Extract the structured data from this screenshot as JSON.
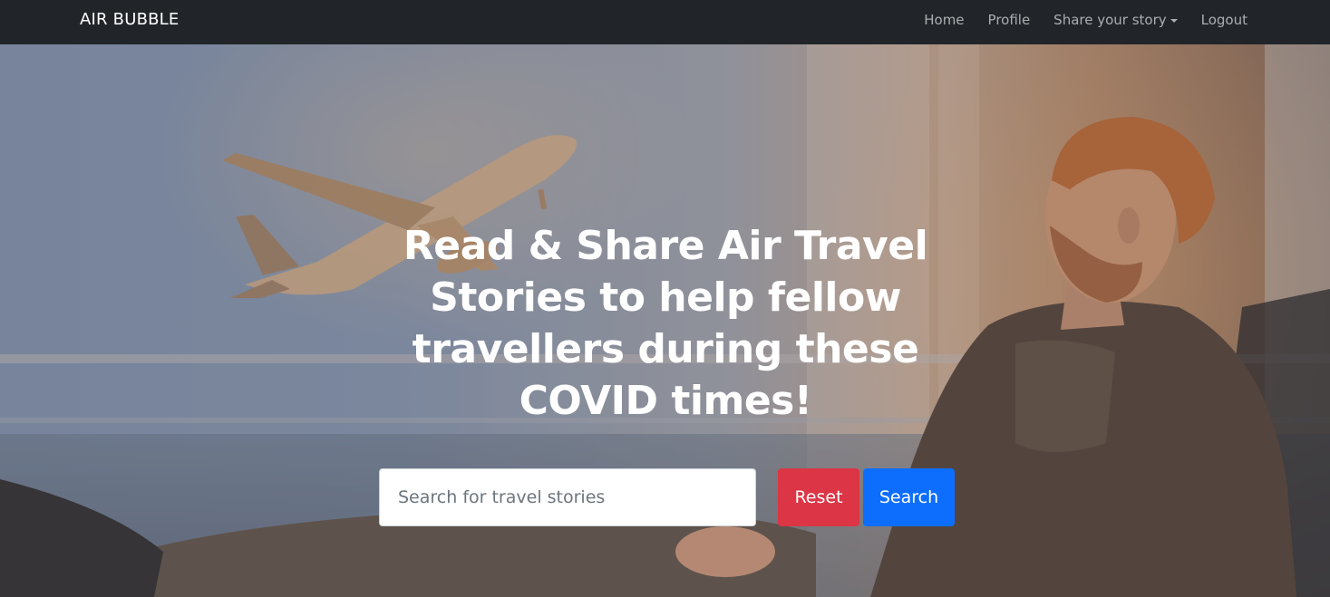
{
  "navbar": {
    "brand": "AIR BUBBLE",
    "links": [
      {
        "label": "Home"
      },
      {
        "label": "Profile"
      },
      {
        "label": "Share your story",
        "has_dropdown": true
      },
      {
        "label": "Logout"
      }
    ],
    "background_color": "#212529"
  },
  "hero": {
    "title": "Read & Share Air Travel Stories to help fellow travellers during these COVID times!",
    "search": {
      "placeholder": "Search for travel stories",
      "value": ""
    },
    "buttons": {
      "reset_label": "Reset",
      "search_label": "Search"
    },
    "colors": {
      "reset": "#dc3545",
      "search": "#0d6efd"
    }
  }
}
